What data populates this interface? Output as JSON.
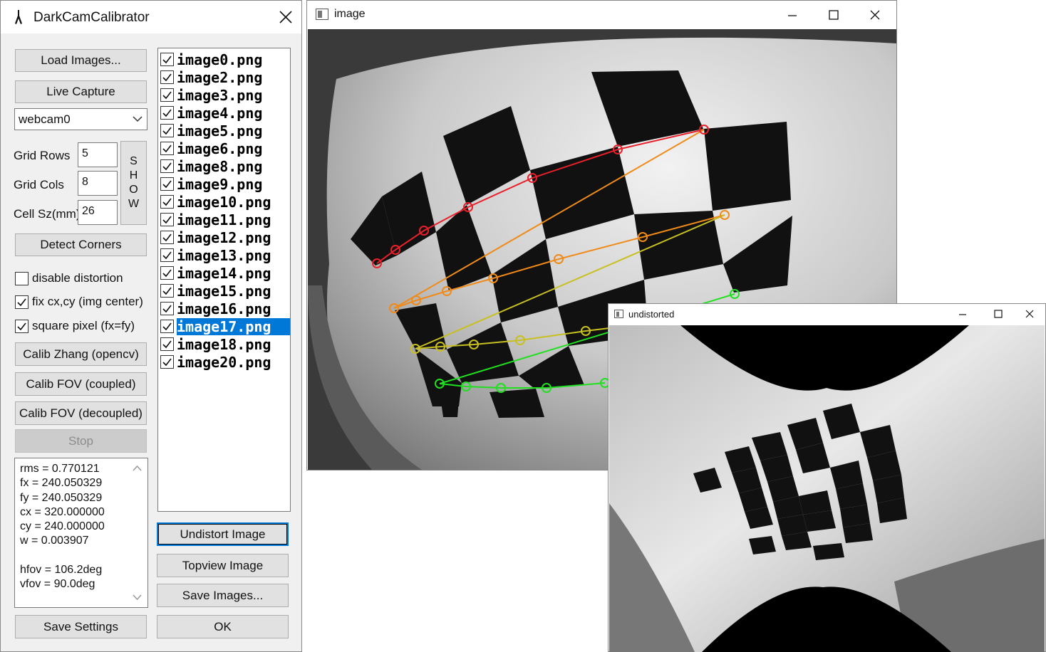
{
  "dialog": {
    "title": "DarkCamCalibrator",
    "buttons": {
      "load_images": "Load Images...",
      "live_capture": "Live Capture",
      "detect_corners": "Detect Corners",
      "calib_zhang": "Calib Zhang (opencv)",
      "calib_fov_coupled": "Calib FOV (coupled)",
      "calib_fov_decoupled": "Calib FOV (decoupled)",
      "stop": "Stop",
      "save_settings": "Save Settings",
      "undistort_image": "Undistort Image",
      "topview_image": "Topview Image",
      "save_images": "Save Images...",
      "ok": "OK"
    },
    "camera_select": {
      "value": "webcam0"
    },
    "grid": {
      "rows_label": "Grid Rows",
      "rows_value": "5",
      "cols_label": "Grid Cols",
      "cols_value": "8",
      "cell_label": "Cell Sz(mm)",
      "cell_value": "26",
      "show_letters": [
        "S",
        "H",
        "O",
        "W"
      ]
    },
    "options": [
      {
        "label": "disable distortion",
        "checked": false
      },
      {
        "label": "fix cx,cy (img center)",
        "checked": true
      },
      {
        "label": "square pixel (fx=fy)",
        "checked": true
      }
    ],
    "results": [
      "rms = 0.770121",
      "fx = 240.050329",
      "fy = 240.050329",
      "cx = 320.000000",
      "cy = 240.000000",
      "w = 0.003907",
      "",
      "hfov = 106.2deg",
      "vfov = 90.0deg"
    ],
    "files": [
      {
        "name": "image0.png",
        "checked": true,
        "selected": false
      },
      {
        "name": "image2.png",
        "checked": true,
        "selected": false
      },
      {
        "name": "image3.png",
        "checked": true,
        "selected": false
      },
      {
        "name": "image4.png",
        "checked": true,
        "selected": false
      },
      {
        "name": "image5.png",
        "checked": true,
        "selected": false
      },
      {
        "name": "image6.png",
        "checked": true,
        "selected": false
      },
      {
        "name": "image8.png",
        "checked": true,
        "selected": false
      },
      {
        "name": "image9.png",
        "checked": true,
        "selected": false
      },
      {
        "name": "image10.png",
        "checked": true,
        "selected": false
      },
      {
        "name": "image11.png",
        "checked": true,
        "selected": false
      },
      {
        "name": "image12.png",
        "checked": true,
        "selected": false
      },
      {
        "name": "image13.png",
        "checked": true,
        "selected": false
      },
      {
        "name": "image14.png",
        "checked": true,
        "selected": false
      },
      {
        "name": "image15.png",
        "checked": true,
        "selected": false
      },
      {
        "name": "image16.png",
        "checked": true,
        "selected": false
      },
      {
        "name": "image17.png",
        "checked": true,
        "selected": true
      },
      {
        "name": "image18.png",
        "checked": true,
        "selected": false
      },
      {
        "name": "image20.png",
        "checked": true,
        "selected": false
      }
    ]
  },
  "image_window": {
    "title": "image"
  },
  "undistorted_window": {
    "title": "undistorted"
  },
  "colors": {
    "selection": "#0078d7",
    "corner_row_red": "#e8202a",
    "corner_row_orange": "#f08a18",
    "corner_row_yellow": "#c8c020",
    "corner_row_green": "#20e020"
  }
}
